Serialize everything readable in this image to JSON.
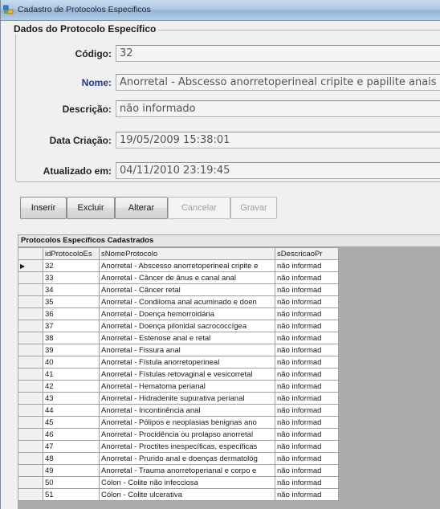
{
  "window": {
    "title": "Cadastro de Protocolos Especificos"
  },
  "form": {
    "group_title": "Dados do Protocolo Específico",
    "codigo_label": "Código:",
    "codigo_value": "32",
    "nome_label": "Nome:",
    "nome_value": "Anorretal - Abscesso anorretoperineal cripite e papilite anais",
    "descricao_label": "Descrição:",
    "descricao_value": "não informado",
    "data_criacao_label": "Data Criação:",
    "data_criacao_value": "19/05/2009 15:38:01",
    "atualizado_label": "Atualizado em:",
    "atualizado_value": "04/11/2010 23:19:45"
  },
  "toolbar": {
    "inserir": "Inserir",
    "excluir": "Excluir",
    "alterar": "Alterar",
    "cancelar": "Cancelar",
    "gravar": "Gravar"
  },
  "grid": {
    "caption": "Protocolos Específicos Cadastrados",
    "columns": [
      "idProtocoloEs",
      "sNomeProtocolo",
      "sDescricaoPr"
    ],
    "selected_index": 0,
    "rows": [
      [
        "32",
        "Anorretal - Abscesso anorretoperineal cripite e",
        "não informad"
      ],
      [
        "33",
        "Anorretal - Câncer de ânus e canal anal",
        "não informad"
      ],
      [
        "34",
        "Anorretal - Câncer retal",
        "não informad"
      ],
      [
        "35",
        "Anorretal - Condiloma anal acuminado e doen",
        "não informad"
      ],
      [
        "36",
        "Anorretal - Doença hemorroidária",
        "não informad"
      ],
      [
        "37",
        "Anorretal - Doença pilonidal sacrococcígea",
        "não informad"
      ],
      [
        "38",
        "Anorretal - Estenose anal e retal",
        "não informad"
      ],
      [
        "39",
        "Anorretal - Fissura anal",
        "não informad"
      ],
      [
        "40",
        "Anorretal - Fístula anorretoperineal",
        "não informad"
      ],
      [
        "41",
        "Anorretal - Fístulas retovaginal e vesicorretal",
        "não informad"
      ],
      [
        "42",
        "Anorretal - Hematoma perianal",
        "não informad"
      ],
      [
        "43",
        "Anorretal - Hidradenite supurativa perianal",
        "não informad"
      ],
      [
        "44",
        "Anorretal - Incontinência anal",
        "não informad"
      ],
      [
        "45",
        "Anorretal - Pólipos e neoplasias benignas ano",
        "não informad"
      ],
      [
        "46",
        "Anorretal - Procidência ou prolapso anorretal",
        "não informad"
      ],
      [
        "47",
        "Anorretal - Proctites inespecíficas, específicas",
        "não informad"
      ],
      [
        "48",
        "Anorretal - Prurido anal e doenças dermatológ",
        "não informad"
      ],
      [
        "49",
        "Anorretal - Trauma anorretoperianal e corpo e",
        "não informad"
      ],
      [
        "50",
        "Cólon - Colite não infecciosa",
        "não informad"
      ],
      [
        "51",
        "Cólon - Colite ulcerativa",
        "não informad"
      ]
    ]
  },
  "colors": {
    "accent_label": "#22359a",
    "grid_background": "#ababab"
  }
}
